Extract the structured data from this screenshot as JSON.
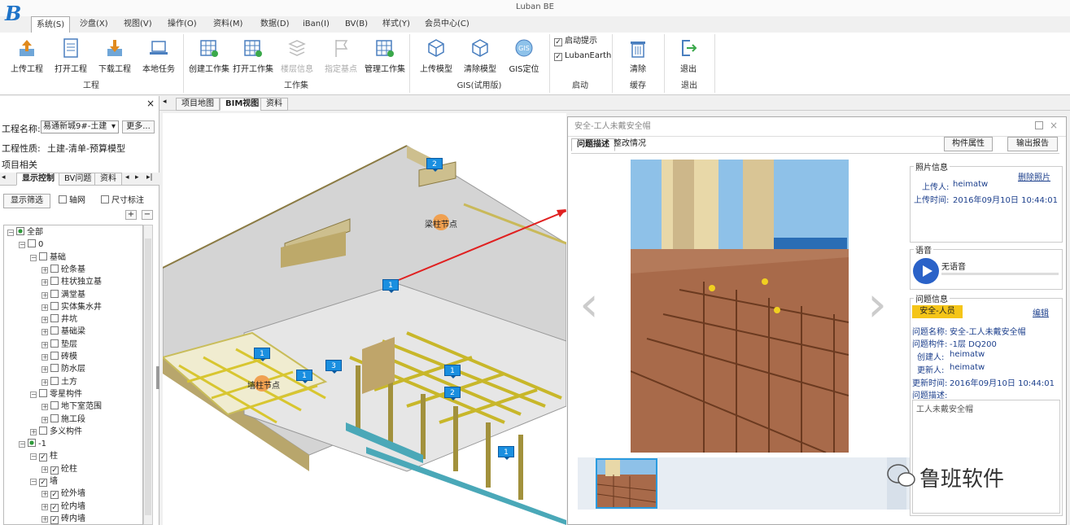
{
  "app": {
    "title": "Luban BE",
    "logo": "B"
  },
  "menu": [
    "系统(S)",
    "沙盘(X)",
    "视图(V)",
    "操作(O)",
    "资料(M)",
    "数据(D)",
    "iBan(I)",
    "BV(B)",
    "样式(Y)",
    "会员中心(C)"
  ],
  "ribbon": {
    "project": {
      "buttons": [
        "上传工程",
        "打开工程",
        "下载工程",
        "本地任务"
      ],
      "group": "工程"
    },
    "workset": {
      "buttons": [
        "创建工作集",
        "打开工作集",
        "楼层信息",
        "指定基点",
        "管理工作集"
      ],
      "group": "工作集"
    },
    "gis": {
      "buttons": [
        "上传模型",
        "清除模型",
        "GIS定位"
      ],
      "group": "GIS(试用版)"
    },
    "startup": {
      "checks": [
        "启动提示",
        "LubanEarth"
      ],
      "group": "启动"
    },
    "cache": {
      "button": "清除",
      "group": "缓存"
    },
    "exit": {
      "button": "退出",
      "group": "退出"
    }
  },
  "left_panel": {
    "close": "×",
    "project_name_label": "工程名称:",
    "project_name_value": "易通新城9#-土建",
    "more_button": "更多...",
    "project_type_label": "工程性质:",
    "project_type_value": "土建-清单-预算模型",
    "project_related": "项目相关",
    "tabs": [
      "显示控制",
      "BV问题",
      "资料"
    ],
    "filter_button": "显示筛选",
    "axis_check": "轴网",
    "dim_check": "尺寸标注",
    "plus": "+",
    "minus": "−",
    "tree": [
      {
        "label": "全部",
        "indent": 0,
        "exp": "−",
        "state": "partial"
      },
      {
        "label": "0",
        "indent": 1,
        "exp": "−",
        "state": "empty"
      },
      {
        "label": "基础",
        "indent": 2,
        "exp": "−",
        "state": "empty"
      },
      {
        "label": "砼条基",
        "indent": 3,
        "exp": "+",
        "state": "empty"
      },
      {
        "label": "柱状独立基",
        "indent": 3,
        "exp": "+",
        "state": "empty"
      },
      {
        "label": "满堂基",
        "indent": 3,
        "exp": "+",
        "state": "empty"
      },
      {
        "label": "实体集水井",
        "indent": 3,
        "exp": "+",
        "state": "empty"
      },
      {
        "label": "井坑",
        "indent": 3,
        "exp": "+",
        "state": "empty"
      },
      {
        "label": "基础梁",
        "indent": 3,
        "exp": "+",
        "state": "empty"
      },
      {
        "label": "垫层",
        "indent": 3,
        "exp": "+",
        "state": "empty"
      },
      {
        "label": "砖模",
        "indent": 3,
        "exp": "+",
        "state": "empty"
      },
      {
        "label": "防水层",
        "indent": 3,
        "exp": "+",
        "state": "empty"
      },
      {
        "label": "土方",
        "indent": 3,
        "exp": "+",
        "state": "empty"
      },
      {
        "label": "零星构件",
        "indent": 2,
        "exp": "−",
        "state": "empty"
      },
      {
        "label": "地下室范围",
        "indent": 3,
        "exp": "+",
        "state": "empty"
      },
      {
        "label": "施工段",
        "indent": 3,
        "exp": "+",
        "state": "empty"
      },
      {
        "label": "多义构件",
        "indent": 2,
        "exp": "+",
        "state": "empty"
      },
      {
        "label": "-1",
        "indent": 1,
        "exp": "−",
        "state": "partial"
      },
      {
        "label": "柱",
        "indent": 2,
        "exp": "−",
        "state": "checked"
      },
      {
        "label": "砼柱",
        "indent": 3,
        "exp": "+",
        "state": "checked"
      },
      {
        "label": "墙",
        "indent": 2,
        "exp": "−",
        "state": "checked"
      },
      {
        "label": "砼外墙",
        "indent": 3,
        "exp": "+",
        "state": "checked"
      },
      {
        "label": "砼内墙",
        "indent": 3,
        "exp": "+",
        "state": "checked"
      },
      {
        "label": "砖内墙",
        "indent": 3,
        "exp": "+",
        "state": "checked"
      }
    ]
  },
  "doc_tabs": [
    "项目地图",
    "BIM视图",
    "资料"
  ],
  "viewport": {
    "markers": [
      "2",
      "1",
      "1",
      "3",
      "1",
      "1",
      "2",
      "1"
    ],
    "labels": [
      "梁柱节点",
      "墙柱节点"
    ]
  },
  "dialog": {
    "title": "安全-工人未戴安全帽",
    "tabs": [
      "问题描述",
      "整改情况"
    ],
    "buttons": [
      "构件属性",
      "输出报告"
    ],
    "photo_info": {
      "header": "照片信息",
      "delete": "删除照片",
      "uploader_label": "上传人:",
      "uploader": "heimatw",
      "time_label": "上传时间:",
      "time": "2016年09月10日 10:44:01"
    },
    "voice": {
      "header": "语音",
      "text": "无语音"
    },
    "issue": {
      "header": "问题信息",
      "tag": "安全-人员",
      "edit": "编辑",
      "rows": [
        {
          "label": "问题名称:",
          "value": "安全-工人未戴安全帽"
        },
        {
          "label": "问题构件:",
          "value": "-1层 DQ200"
        },
        {
          "label": "创建人:",
          "value": "heimatw"
        },
        {
          "label": "更新人:",
          "value": "heimatw"
        },
        {
          "label": "更新时间:",
          "value": "2016年09月10日 10:44:01"
        },
        {
          "label": "问题描述:",
          "value": ""
        }
      ],
      "description": "工人未戴安全帽"
    },
    "prev": "‹",
    "next": "›"
  },
  "watermark": "鲁班软件",
  "colors": {
    "accent": "#1e73c8",
    "marker": "#1a8fe0",
    "tag": "#f5c518",
    "arrow": "#e02020"
  }
}
